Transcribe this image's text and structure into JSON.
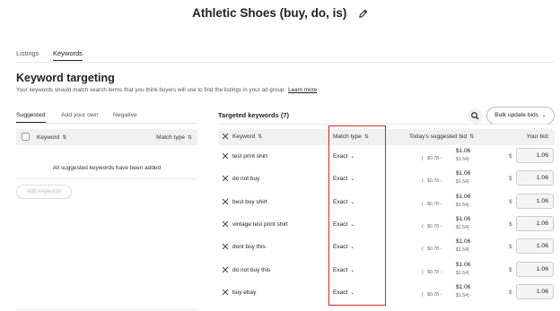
{
  "title": "Athletic Shoes (buy, do, is)",
  "page_tabs": [
    "Listings",
    "Keywords"
  ],
  "active_page_tab": "Keywords",
  "section": {
    "title": "Keyword targeting",
    "description": "Your keywords should match search terms that you think buyers will use to find the listings in your ad group.",
    "learn_more": "Learn more"
  },
  "left_panel": {
    "tabs": [
      "Suggested",
      "Add your own",
      "Negative"
    ],
    "active_tab": "Suggested",
    "header": {
      "keyword": "Keyword",
      "match_type": "Match type"
    },
    "empty_message": "All suggested keywords have been added",
    "add_button": "Add keywords"
  },
  "right_panel": {
    "title": "Targeted keywords (7)",
    "bulk_button": "Bulk update bids",
    "header": {
      "keyword": "Keyword",
      "match_type": "Match type",
      "suggested_bid": "Today's suggested bid",
      "your_bid": "Your bid:"
    },
    "rows": [
      {
        "keyword": "test print shirt",
        "match": "Exact",
        "range_low": "$0.78 -",
        "suggested": "$1.06",
        "range_high": "$1.54)",
        "bid": "1.06"
      },
      {
        "keyword": "do not buy",
        "match": "Exact",
        "range_low": "$0.78 -",
        "suggested": "$1.06",
        "range_high": "$1.54)",
        "bid": "1.06"
      },
      {
        "keyword": "best buy shirt",
        "match": "Exact",
        "range_low": "$0.78 -",
        "suggested": "$1.06",
        "range_high": "$1.54)",
        "bid": "1.06"
      },
      {
        "keyword": "vintage test print shirt",
        "match": "Exact",
        "range_low": "$0.78 -",
        "suggested": "$1.06",
        "range_high": "$1.54)",
        "bid": "1.06"
      },
      {
        "keyword": "dont buy this",
        "match": "Exact",
        "range_low": "$0.78 -",
        "suggested": "$1.06",
        "range_high": "$1.54)",
        "bid": "1.06"
      },
      {
        "keyword": "do not buy this",
        "match": "Exact",
        "range_low": "$0.78 -",
        "suggested": "$1.06",
        "range_high": "$1.54)",
        "bid": "1.06"
      },
      {
        "keyword": "buy ebay",
        "match": "Exact",
        "range_low": "$0.78 -",
        "suggested": "$1.06",
        "range_high": "$1.54)",
        "bid": "1.06"
      }
    ]
  },
  "colors": {
    "highlight": "#d9241e",
    "header_bg": "#f1f1f1"
  },
  "icons": {
    "edit": "pencil-icon",
    "search": "search-icon",
    "remove": "close-icon",
    "sort": "sort-icon",
    "dropdown": "chevron-down-icon"
  }
}
